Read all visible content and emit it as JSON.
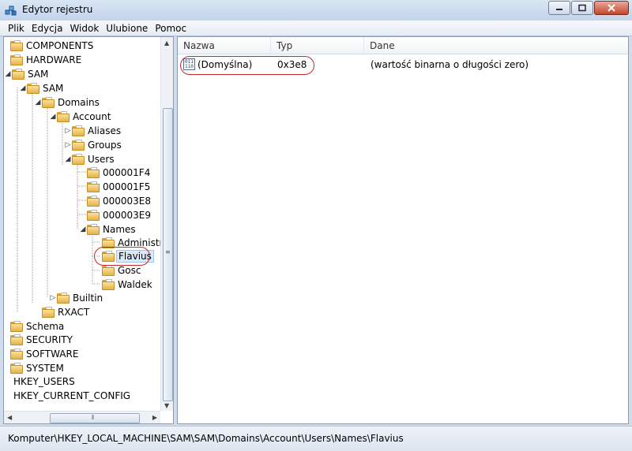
{
  "window": {
    "title": "Edytor rejestru",
    "minimize_icon": "minimize-icon",
    "maximize_icon": "maximize-icon",
    "close_icon": "close-icon"
  },
  "menu": [
    {
      "label": "Plik"
    },
    {
      "label": "Edycja"
    },
    {
      "label": "Widok"
    },
    {
      "label": "Ulubione"
    },
    {
      "label": "Pomoc"
    }
  ],
  "tree": {
    "items": [
      {
        "label": "COMPONENTS",
        "level": 0,
        "expander": "none",
        "icon": "folder-icon"
      },
      {
        "label": "HARDWARE",
        "level": 0,
        "expander": "none",
        "icon": "folder-icon"
      },
      {
        "label": "SAM",
        "level": 0,
        "expander": "expanded",
        "icon": "folder-icon"
      },
      {
        "label": "SAM",
        "level": 1,
        "expander": "expanded",
        "icon": "folder-icon"
      },
      {
        "label": "Domains",
        "level": 2,
        "expander": "expanded",
        "icon": "folder-icon"
      },
      {
        "label": "Account",
        "level": 3,
        "expander": "expanded",
        "icon": "folder-icon"
      },
      {
        "label": "Aliases",
        "level": 4,
        "expander": "collapsed",
        "icon": "folder-icon"
      },
      {
        "label": "Groups",
        "level": 4,
        "expander": "collapsed",
        "icon": "folder-icon"
      },
      {
        "label": "Users",
        "level": 4,
        "expander": "expanded",
        "icon": "folder-icon"
      },
      {
        "label": "000001F4",
        "level": 5,
        "expander": "none",
        "icon": "folder-icon"
      },
      {
        "label": "000001F5",
        "level": 5,
        "expander": "none",
        "icon": "folder-icon"
      },
      {
        "label": "000003E8",
        "level": 5,
        "expander": "none",
        "icon": "folder-icon"
      },
      {
        "label": "000003E9",
        "level": 5,
        "expander": "none",
        "icon": "folder-icon"
      },
      {
        "label": "Names",
        "level": 5,
        "expander": "expanded",
        "icon": "folder-icon"
      },
      {
        "label": "Administra",
        "level": 6,
        "expander": "none",
        "icon": "folder-icon"
      },
      {
        "label": "Flavius",
        "level": 6,
        "expander": "none",
        "icon": "folder-icon",
        "selected": true
      },
      {
        "label": "Gosc",
        "level": 6,
        "expander": "none",
        "icon": "folder-icon"
      },
      {
        "label": "Waldek",
        "level": 6,
        "expander": "none",
        "icon": "folder-icon"
      },
      {
        "label": "Builtin",
        "level": 3,
        "expander": "collapsed",
        "icon": "folder-icon"
      },
      {
        "label": "RXACT",
        "level": 2,
        "expander": "none",
        "icon": "folder-icon"
      },
      {
        "label": "Schema",
        "level": 0,
        "expander": "none",
        "icon": "folder-icon"
      },
      {
        "label": "SECURITY",
        "level": 0,
        "expander": "none",
        "icon": "folder-icon"
      },
      {
        "label": "SOFTWARE",
        "level": 0,
        "expander": "none",
        "icon": "folder-icon"
      },
      {
        "label": "SYSTEM",
        "level": 0,
        "expander": "none",
        "icon": "folder-icon"
      },
      {
        "label": "HKEY_USERS",
        "level": -1,
        "expander": "none",
        "icon": "none"
      },
      {
        "label": "HKEY_CURRENT_CONFIG",
        "level": -1,
        "expander": "none",
        "icon": "none"
      }
    ]
  },
  "list": {
    "columns": [
      "Nazwa",
      "Typ",
      "Dane"
    ],
    "rows": [
      {
        "name": "(Domyślna)",
        "type": "0x3e8",
        "data": "(wartość binarna o długości zero)",
        "icon": "binary-value-icon"
      }
    ]
  },
  "status": {
    "path": "Komputer\\HKEY_LOCAL_MACHINE\\SAM\\SAM\\Domains\\Account\\Users\\Names\\Flavius"
  },
  "colors": {
    "highlight": "#c62828",
    "folder": "#e6b24a"
  }
}
